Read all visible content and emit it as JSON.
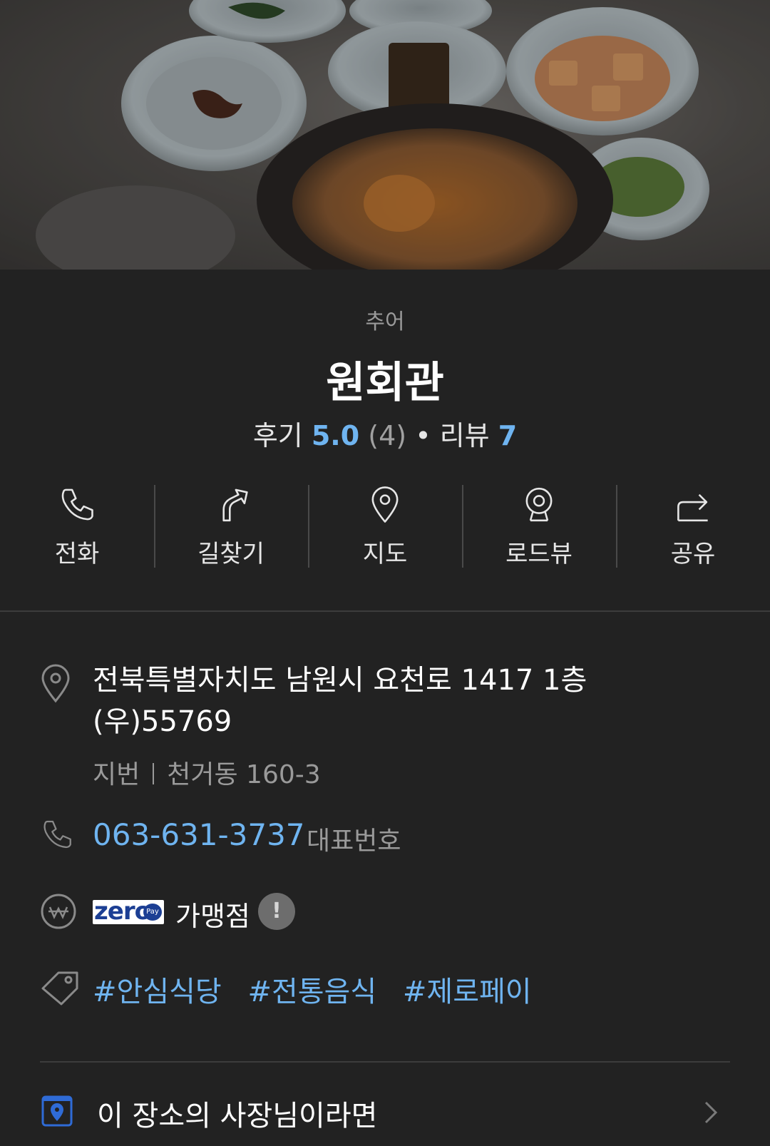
{
  "place": {
    "category": "추어",
    "name": "원회관",
    "stats": {
      "review_label": "후기",
      "rating": "5.0",
      "rating_count": "(4)",
      "separator": "•",
      "blog_label": "리뷰",
      "blog_count": "7"
    }
  },
  "actions": [
    {
      "label": "전화",
      "icon": "phone-icon"
    },
    {
      "label": "길찾기",
      "icon": "directions-icon"
    },
    {
      "label": "지도",
      "icon": "map-pin-icon"
    },
    {
      "label": "로드뷰",
      "icon": "roadview-camera-icon"
    },
    {
      "label": "공유",
      "icon": "share-icon"
    }
  ],
  "info": {
    "address_line1": "전북특별자치도 남원시 요천로 1417 1층",
    "address_line2": "(우)55769",
    "jibun_label": "지번",
    "jibun_value": "천거동 160-3",
    "phone": "063-631-3737",
    "phone_note": "대표번호",
    "zeropay_logo": "zero",
    "zeropay_logo_sub": "Pay",
    "zeropay_label": "가맹점",
    "info_mark": "!",
    "tags": [
      "#안심식당",
      "#전통음식",
      "#제로페이"
    ],
    "owner_link": "이 장소의 사장님이라면"
  },
  "colors": {
    "background": "#222222",
    "accent_blue": "#6fb4f0",
    "muted": "#9a9a9a"
  }
}
